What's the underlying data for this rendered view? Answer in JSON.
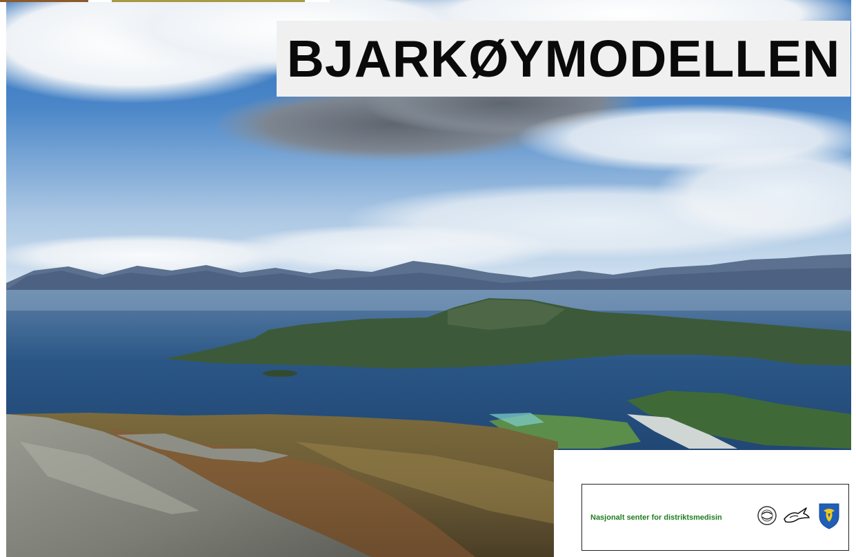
{
  "title": "BJARKØYMODELLEN",
  "logo_box": {
    "organization": "Nasjonalt senter for distriktsmedisin",
    "icons": [
      "emblem-icon",
      "bird-icon",
      "coat-of-arms-icon"
    ]
  },
  "colors": {
    "title_text": "#0a0a0a",
    "title_background": "#f0f0f0",
    "organization_text": "#1e7d1e",
    "sky": "#4a86c8",
    "sea": "#27507e"
  }
}
